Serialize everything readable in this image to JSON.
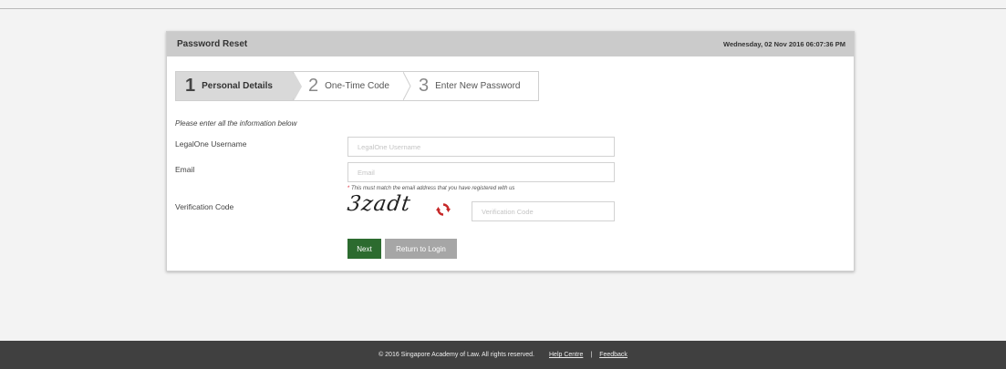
{
  "panel": {
    "title": "Password Reset",
    "datetime": "Wednesday, 02 Nov 2016 06:07:36 PM"
  },
  "steps": [
    {
      "number": "1",
      "label": "Personal Details",
      "active": true
    },
    {
      "number": "2",
      "label": "One-Time Code",
      "active": false
    },
    {
      "number": "3",
      "label": "Enter New Password",
      "active": false
    }
  ],
  "form": {
    "instruction": "Please enter all the information below",
    "username_label": "LegalOne Username",
    "username_placeholder": "LegalOne Username",
    "username_value": "",
    "email_label": "Email",
    "email_placeholder": "Email",
    "email_value": "",
    "email_hint_star": "*",
    "email_hint": " This must match the email address that you have registered with us",
    "verification_label": "Verification Code",
    "captcha_text": "3zadt",
    "verification_placeholder": "Verification Code",
    "verification_value": "",
    "refresh_icon": "refresh-icon"
  },
  "buttons": {
    "next_label": "Next",
    "return_label": "Return to Login"
  },
  "footer": {
    "copyright": "© 2016 Singapore Academy of Law. All rights reserved.",
    "help_link": "Help Centre",
    "separator": "|",
    "feedback_link": "Feedback"
  },
  "colors": {
    "next_button": "#2c6b2f",
    "return_button": "#a6a6a6",
    "footer_bg": "#404040",
    "header_bg": "#cbcbcb",
    "active_step_bg": "#d9d9d9"
  }
}
